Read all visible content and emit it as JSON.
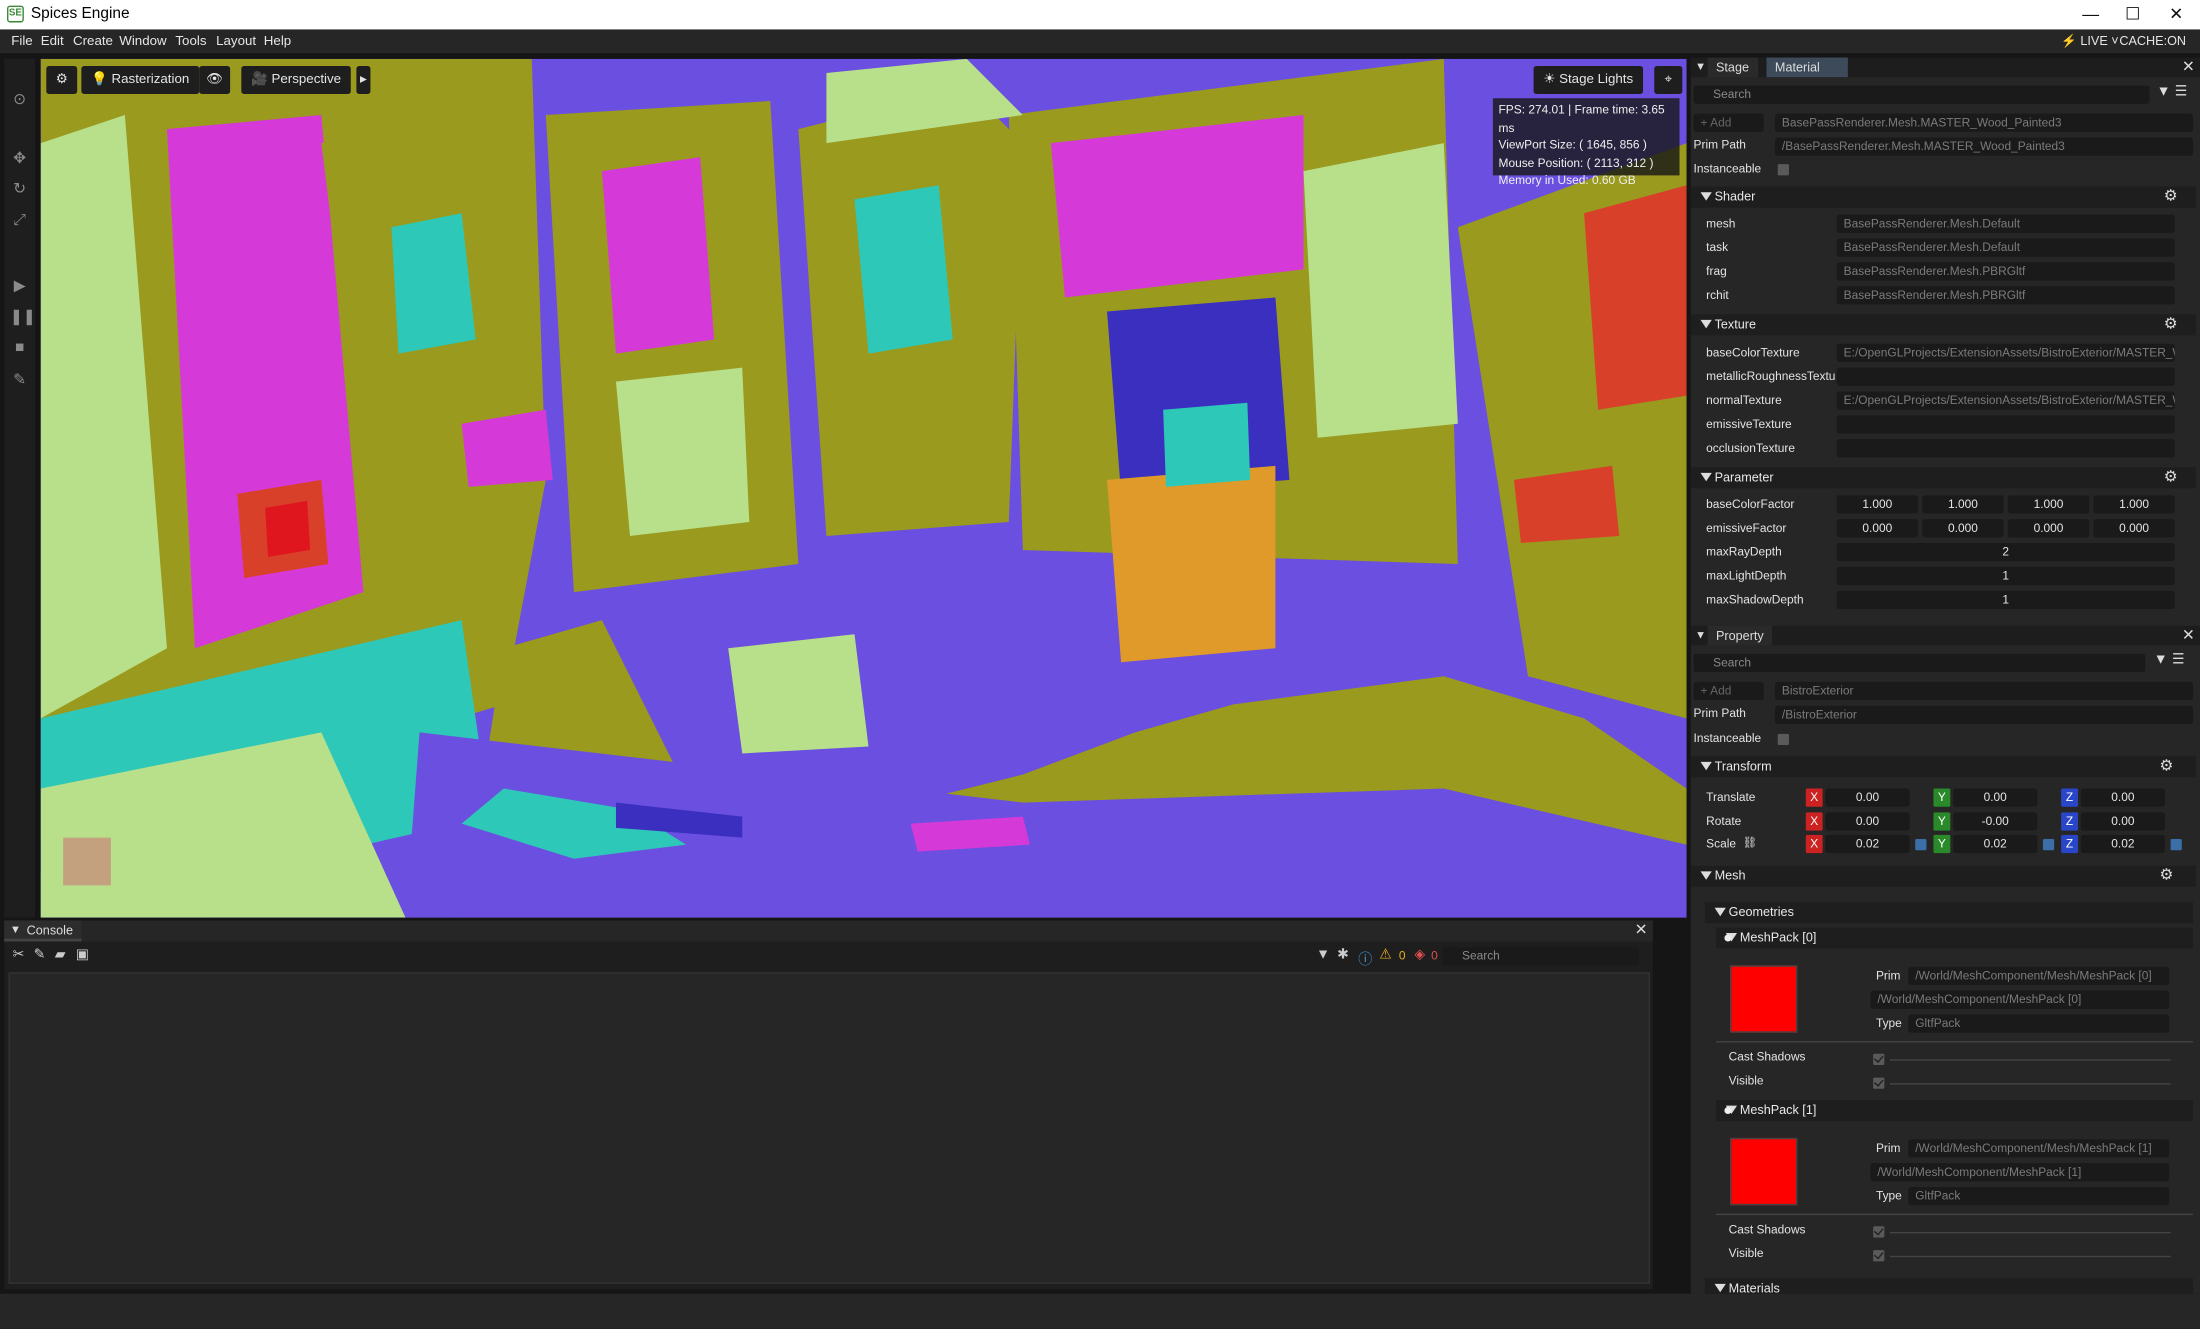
{
  "window": {
    "title": "Spices Engine",
    "app_icon": "app-icon",
    "minimize": "—",
    "maximize": "☐",
    "close": "✕"
  },
  "menu": {
    "items": [
      "File",
      "Edit",
      "Create",
      "Window",
      "Tools",
      "Layout",
      "Help"
    ],
    "live": "LIVE",
    "cache": "CACHE:ON"
  },
  "viewport": {
    "render_mode": "Rasterization",
    "camera": "Perspective",
    "stage_lights": "Stage Lights",
    "stats": {
      "fps": "FPS: 274.01 | Frame time: 3.65 ms",
      "viewport_size": "ViewPort Size: ( 1645, 856 )",
      "mouse": "Mouse Position: ( 2113, 312 )",
      "memory": "Memory in Used: 0.60 GB"
    },
    "colors": [
      "#6a4fe0",
      "#9a9a1e",
      "#d53ad8",
      "#2ec8b8",
      "#d8402a",
      "#b8e08a",
      "#3a2fbf",
      "#e09a2a"
    ]
  },
  "console": {
    "tab": "Console",
    "warnings": "0",
    "errors": "0",
    "search_placeholder": "Search"
  },
  "stage_panel": {
    "tabs": [
      "Stage",
      "Material"
    ],
    "search_placeholder": "Search",
    "add": "Add",
    "name": "BasePassRenderer.Mesh.MASTER_Wood_Painted3",
    "prim_path_label": "Prim Path",
    "prim_path": "/BasePassRenderer.Mesh.MASTER_Wood_Painted3",
    "instanceable_label": "Instanceable",
    "shader": {
      "title": "Shader",
      "rows": [
        {
          "k": "mesh",
          "v": "BasePassRenderer.Mesh.Default"
        },
        {
          "k": "task",
          "v": "BasePassRenderer.Mesh.Default"
        },
        {
          "k": "frag",
          "v": "BasePassRenderer.Mesh.PBRGltf"
        },
        {
          "k": "rchit",
          "v": "BasePassRenderer.Mesh.PBRGltf"
        }
      ]
    },
    "texture": {
      "title": "Texture",
      "rows": [
        {
          "k": "baseColorTexture",
          "v": "E:/OpenGLProjects/ExtensionAssets/BistroExterior/MASTER_W"
        },
        {
          "k": "metallicRoughnessTextu",
          "v": ""
        },
        {
          "k": "normalTexture",
          "v": "E:/OpenGLProjects/ExtensionAssets/BistroExterior/MASTER_W"
        },
        {
          "k": "emissiveTexture",
          "v": ""
        },
        {
          "k": "occlusionTexture",
          "v": ""
        }
      ]
    },
    "parameter": {
      "title": "Parameter",
      "baseColorFactor_label": "baseColorFactor",
      "baseColorFactor": [
        "1.000",
        "1.000",
        "1.000",
        "1.000"
      ],
      "emissiveFactor_label": "emissiveFactor",
      "emissiveFactor": [
        "0.000",
        "0.000",
        "0.000",
        "0.000"
      ],
      "maxRayDepth_label": "maxRayDepth",
      "maxRayDepth": "2",
      "maxLightDepth_label": "maxLightDepth",
      "maxLightDepth": "1",
      "maxShadowDepth_label": "maxShadowDepth",
      "maxShadowDepth": "1"
    }
  },
  "property_panel": {
    "tab": "Property",
    "search_placeholder": "Search",
    "add": "Add",
    "name": "BistroExterior",
    "prim_path_label": "Prim Path",
    "prim_path": "/BistroExterior",
    "instanceable_label": "Instanceable",
    "transform": {
      "title": "Transform",
      "translate_label": "Translate",
      "translate": [
        "0.00",
        "0.00",
        "0.00"
      ],
      "rotate_label": "Rotate",
      "rotate": [
        "0.00",
        "-0.00",
        "0.00"
      ],
      "scale_label": "Scale",
      "scale": [
        "0.02",
        "0.02",
        "0.02"
      ],
      "x": "X",
      "y": "Y",
      "z": "Z"
    },
    "mesh": {
      "title": "Mesh",
      "geometries": "Geometries",
      "packs": [
        {
          "name": "MeshPack [0]",
          "prim_label": "Prim",
          "prim": "/World/MeshComponent/Mesh/MeshPack [0]",
          "prim2": "/World/MeshComponent/MeshPack [0]",
          "type_label": "Type",
          "type": "GltfPack",
          "cast_shadows": "Cast Shadows",
          "visible": "Visible",
          "color": "#ff0000"
        },
        {
          "name": "MeshPack [1]",
          "prim_label": "Prim",
          "prim": "/World/MeshComponent/Mesh/MeshPack [1]",
          "prim2": "/World/MeshComponent/MeshPack [1]",
          "type_label": "Type",
          "type": "GltfPack",
          "cast_shadows": "Cast Shadows",
          "visible": "Visible",
          "color": "#ff0000"
        }
      ],
      "materials": "Materials"
    }
  }
}
